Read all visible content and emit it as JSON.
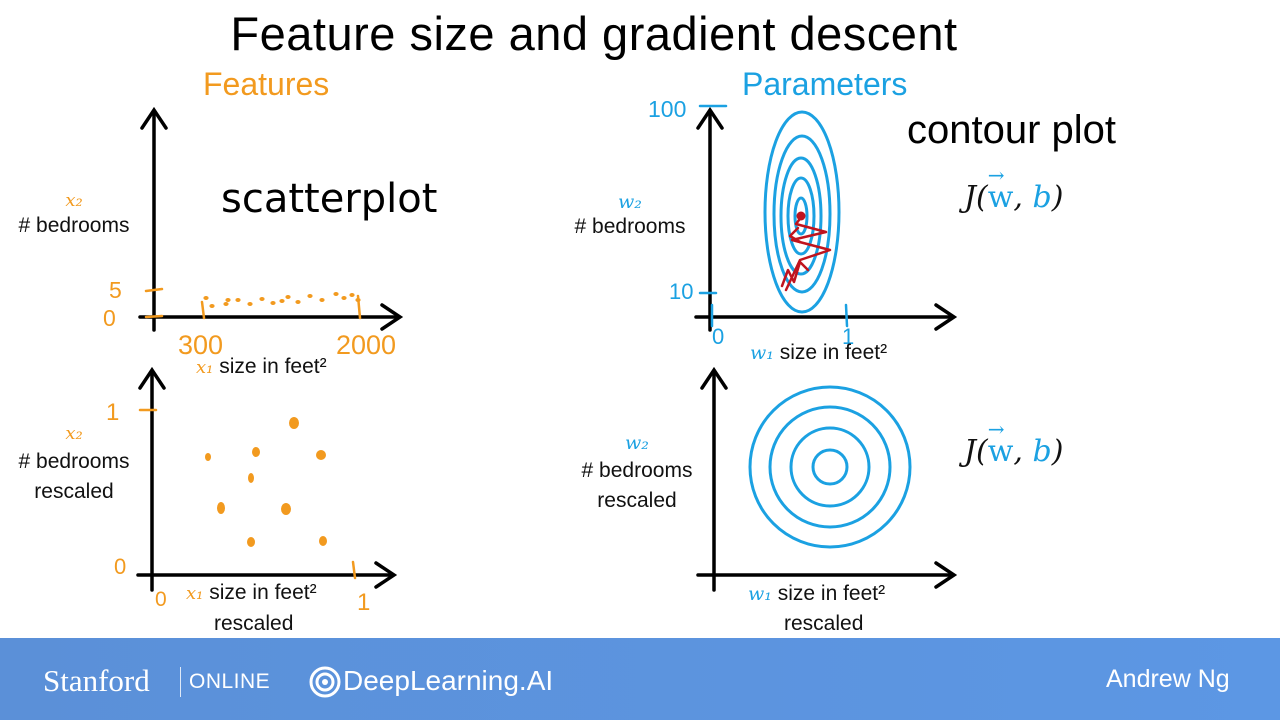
{
  "title": "Feature size and gradient descent",
  "features": {
    "heading": "Features",
    "annotation": "scatterplot",
    "top": {
      "y_var": "x₂",
      "y_label": "# bedrooms",
      "x_var": "x₁",
      "x_label": "size in feet²",
      "y_ticks": [
        "5",
        "0"
      ],
      "x_ticks": [
        "300",
        "2000"
      ]
    },
    "bottom": {
      "y_var": "x₂",
      "y_label_line1": "# bedrooms",
      "y_label_line2": "rescaled",
      "x_var": "x₁",
      "x_label_line1": "size in feet²",
      "x_label_line2": "rescaled",
      "y_ticks": [
        "1",
        "0"
      ],
      "x_ticks": [
        "0",
        "1"
      ]
    }
  },
  "parameters": {
    "heading": "Parameters",
    "annotation": "contour plot",
    "top": {
      "y_var": "w₂",
      "y_label": "# bedrooms",
      "x_var": "w₁",
      "x_label": "size in feet²",
      "y_ticks": [
        "100",
        "10"
      ],
      "x_ticks": [
        "0",
        "1"
      ],
      "cost": {
        "j": "J(",
        "w": "w",
        "sep": ",",
        "b": "b",
        "close": ")"
      }
    },
    "bottom": {
      "y_var": "w₂",
      "y_label_line1": "# bedrooms",
      "y_label_line2": "rescaled",
      "x_var": "w₁",
      "x_label_line1": "size in feet²",
      "x_label_line2": "rescaled",
      "cost": {
        "j": "J(",
        "w": "w",
        "sep": ",",
        "b": "b",
        "close": ")"
      }
    }
  },
  "footer": {
    "stanford": "Stanford",
    "online": "ONLINE",
    "deeplearning": "DeepLearning.AI",
    "author": "Andrew Ng"
  },
  "colors": {
    "orange": "#F29A1F",
    "blue": "#1BA1E2",
    "red": "#C0141E",
    "footer": "#5c94e0"
  }
}
